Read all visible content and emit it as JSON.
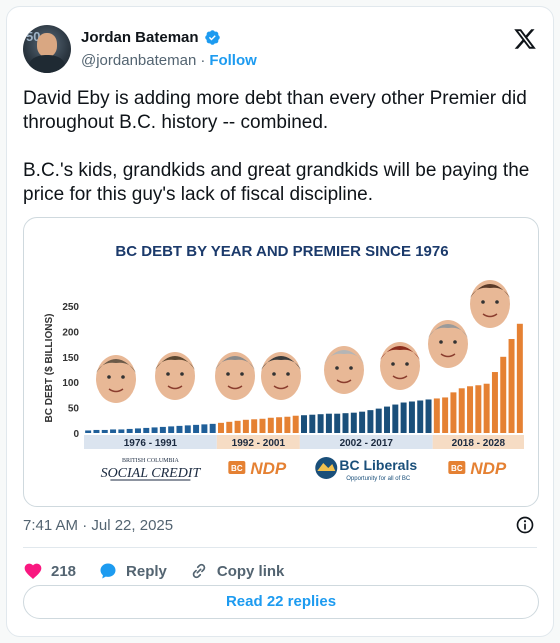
{
  "author": {
    "name": "Jordan Bateman",
    "handle": "@jordanbateman",
    "separator": "·",
    "follow_label": "Follow",
    "avatar_icon": "profile-avatar",
    "verified_icon": "verified-badge-icon"
  },
  "tweet": {
    "paragraphs": [
      "David Eby is adding more debt than every other Premier did throughout B.C. history -- combined.",
      "B.C.'s kids, grandkids and great grandkids will be paying the price for this guy's lack of fiscal discipline."
    ],
    "timestamp": "7:41 AM · Jul 22, 2025"
  },
  "actions": {
    "like_count": "218",
    "reply_label": "Reply",
    "copy_link_label": "Copy link",
    "read_replies_label": "Read 22 replies"
  },
  "colors": {
    "accent": "#1d9bf0",
    "heart": "#f91880",
    "socred_bar": "#1f5f99",
    "ndp_bar": "#e58133",
    "liberal_bar": "#1a4f7a"
  },
  "chart_data": {
    "type": "bar",
    "title": "BC DEBT BY YEAR AND PREMIER SINCE 1976",
    "ylabel": "BC DEBT ($ BILLIONS)",
    "ylim": [
      0,
      250
    ],
    "yticks": [
      0,
      50,
      100,
      150,
      200,
      250
    ],
    "periods": [
      {
        "label": "1976 - 1991",
        "party": "SOCIAL CREDIT",
        "party_sub": "BRITISH COLUMBIA",
        "color": "#1f5f99",
        "values": [
          5,
          6,
          6,
          7,
          7,
          8,
          9,
          10,
          11,
          12,
          13,
          14,
          15,
          16,
          17,
          18
        ]
      },
      {
        "label": "1992 - 2001",
        "party": "NDP",
        "party_prefix": "BC",
        "color": "#e58133",
        "values": [
          20,
          22,
          24,
          26,
          27,
          28,
          30,
          31,
          32,
          34
        ]
      },
      {
        "label": "2002 - 2017",
        "party": "BC Liberals",
        "party_sub": "Opportunity for all of BC",
        "color": "#1a4f7a",
        "values": [
          35,
          36,
          37,
          38,
          38,
          39,
          40,
          42,
          45,
          48,
          52,
          56,
          60,
          62,
          64,
          66
        ]
      },
      {
        "label": "2018 - 2028",
        "party": "NDP",
        "party_prefix": "BC",
        "color": "#e58133",
        "values": [
          68,
          70,
          80,
          88,
          92,
          94,
          97,
          120,
          150,
          185,
          215
        ]
      }
    ]
  }
}
